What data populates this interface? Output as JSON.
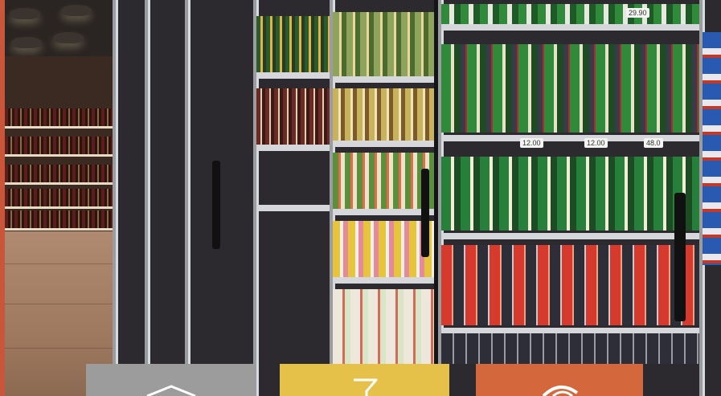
{
  "colors": {
    "edge_strip": "#c9553a",
    "tile_gray": "#9c9c9c",
    "tile_yellow": "#e5c14a",
    "tile_orange": "#d4673c"
  },
  "price_tags": [
    "29.90",
    "12.00",
    "12.00",
    "48.0"
  ],
  "bottom_tiles": [
    {
      "name": "gray-tile",
      "color": "#9c9c9c",
      "icon": "house-icon"
    },
    {
      "name": "yellow-tile",
      "color": "#e5c14a",
      "icon": "cocktail-glass-icon"
    },
    {
      "name": "orange-tile",
      "color": "#d4673c",
      "icon": "globe-icon"
    }
  ]
}
